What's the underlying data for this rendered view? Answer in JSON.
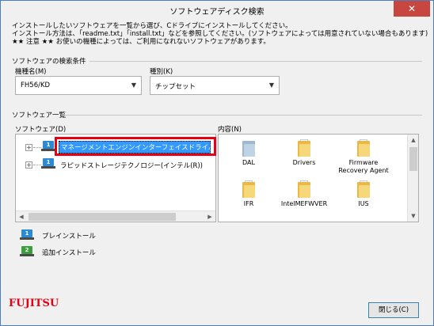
{
  "window": {
    "title": "ソフトウェアディスク検索",
    "close_glyph": "✕"
  },
  "description": {
    "line1": "インストールしたいソフトウェアを一覧から選び、Cドライブにインストールしてください。",
    "line2": "インストール方法は、「readme.txt」「install.txt」などを参照してください。(ソフトウェアによっては用意されていない場合もあります)",
    "line3": "★★ 注意 ★★ お使いの機種によっては、ご利用になれないソフトウェアがあります。"
  },
  "search_conditions": {
    "group_label": "ソフトウェアの検索条件",
    "model_label": "機種名(M)",
    "model_value": "FH56/KD",
    "category_label": "種別(K)",
    "category_value": "チップセット"
  },
  "software_list": {
    "group_label": "ソフトウェア一覧",
    "software_label": "ソフトウェア(D)",
    "contents_label": "内容(N)",
    "tree_items": [
      {
        "label": "マネージメントエンジンインターフェイスドライバー(イン",
        "icon_number": "1",
        "icon_color": "#2a8ad4",
        "selected": true
      },
      {
        "label": "ラピッドストレージテクノロジー(インテル(R))",
        "icon_number": "1",
        "icon_color": "#2a8ad4",
        "selected": false
      }
    ],
    "contents": [
      {
        "name": "DAL",
        "icon": "folder-with-document-icon"
      },
      {
        "name": "Drivers",
        "icon": "folder-icon"
      },
      {
        "name": "Firmware Recovery Agent",
        "icon": "folder-icon"
      },
      {
        "name": "IFR",
        "icon": "folder-icon"
      },
      {
        "name": "IntelMEFWVER",
        "icon": "folder-icon"
      },
      {
        "name": "IUS",
        "icon": "folder-icon"
      }
    ]
  },
  "legend": {
    "preinstall_label": "プレインストール",
    "preinstall_number": "1",
    "preinstall_color": "#2a8ad4",
    "addinstall_label": "追加インストール",
    "addinstall_number": "2",
    "addinstall_color": "#3aa03a"
  },
  "footer": {
    "logo_text": "FUJITSU",
    "close_button_label": "閉じる(C)"
  },
  "colors": {
    "highlight": "#e60012",
    "selection": "#3399ff",
    "brand": "#e60012"
  }
}
